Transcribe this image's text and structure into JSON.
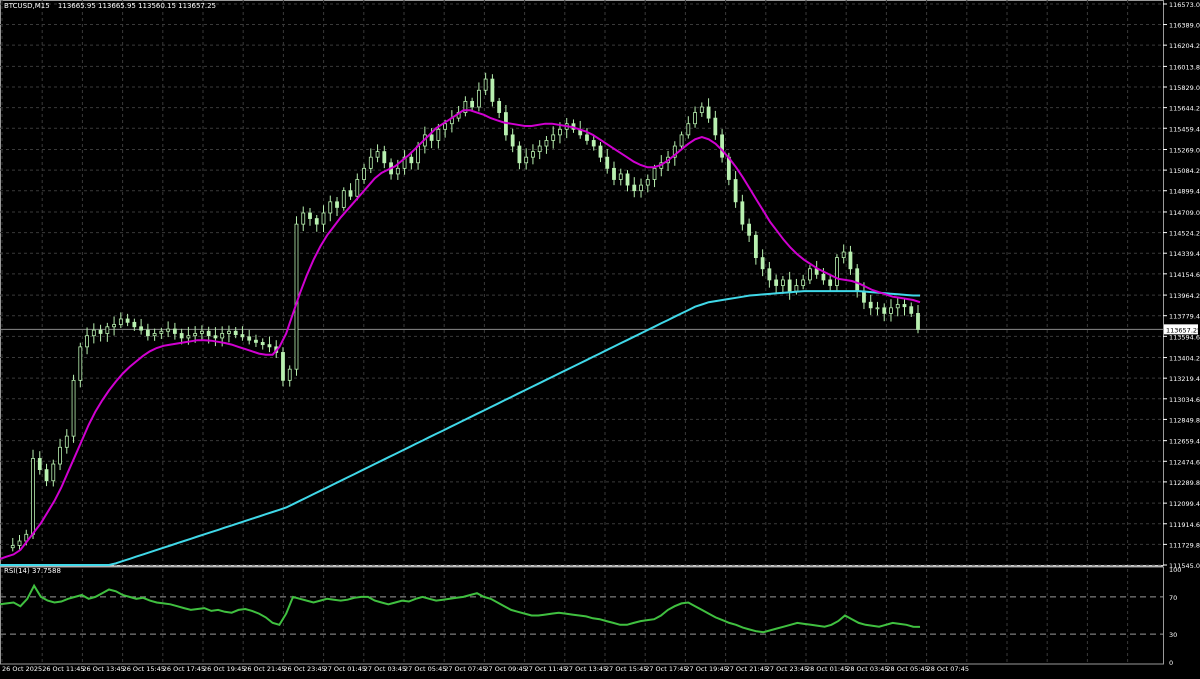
{
  "header": {
    "symbol": "BTCUSD,M15",
    "ohlc": "113665.95 113665.95 113560.15 113657.25"
  },
  "rsi_header": {
    "label": "RSI(14) 37.7588"
  },
  "colors": {
    "background": "#000000",
    "grid": "#3a3a3a",
    "bull_candle": "#b8f0b0",
    "ma_fast": "#d000d0",
    "ma_slow": "#40d8e8",
    "rsi_line": "#40c040",
    "axis_text": "#ffffff"
  },
  "chart_data": {
    "type": "line",
    "title": "BTCUSD,M15",
    "price_axis_labels": [
      "116573.00",
      "116389.00",
      "116204.20",
      "116013.80",
      "115829.00",
      "115644.20",
      "115459.40",
      "115269.00",
      "115084.20",
      "114899.40",
      "114709.00",
      "114524.20",
      "114339.40",
      "114154.60",
      "113964.20",
      "113779.40",
      "113594.60",
      "113404.20",
      "113219.40",
      "113034.60",
      "112849.80",
      "112659.40",
      "112474.60",
      "112289.80",
      "112099.40",
      "111914.60",
      "111729.80",
      "111545.00"
    ],
    "price_range": [
      111545.0,
      116573.0
    ],
    "current_price_label": "113657.25",
    "current_price": 113657.25,
    "time_axis_labels": [
      "26 Oct 2025",
      "26 Oct 11:45",
      "26 Oct 13:45",
      "26 Oct 15:45",
      "26 Oct 17:45",
      "26 Oct 19:45",
      "26 Oct 21:45",
      "26 Oct 23:45",
      "27 Oct 01:45",
      "27 Oct 03:45",
      "27 Oct 05:45",
      "27 Oct 07:45",
      "27 Oct 09:45",
      "27 Oct 11:45",
      "27 Oct 13:45",
      "27 Oct 15:45",
      "27 Oct 17:45",
      "27 Oct 19:45",
      "27 Oct 21:45",
      "27 Oct 23:45",
      "28 Oct 01:45",
      "28 Oct 03:45",
      "28 Oct 05:45",
      "28 Oct 07:45"
    ],
    "close_series": [
      111700,
      111720,
      111760,
      111820,
      112500,
      112400,
      112300,
      112450,
      112600,
      112700,
      113200,
      113500,
      113600,
      113650,
      113620,
      113680,
      113700,
      113750,
      113720,
      113680,
      113650,
      113600,
      113620,
      113640,
      113660,
      113620,
      113580,
      113600,
      113620,
      113640,
      113600,
      113580,
      113620,
      113640,
      113610,
      113590,
      113560,
      113540,
      113520,
      113500,
      113450,
      113200,
      113300,
      114600,
      114700,
      114650,
      114600,
      114700,
      114800,
      114750,
      114900,
      114850,
      115000,
      115100,
      115200,
      115250,
      115150,
      115050,
      115100,
      115200,
      115150,
      115300,
      115400,
      115350,
      115450,
      115500,
      115550,
      115600,
      115700,
      115650,
      115800,
      115900,
      115700,
      115600,
      115400,
      115300,
      115150,
      115200,
      115250,
      115300,
      115350,
      115400,
      115450,
      115500,
      115450,
      115400,
      115350,
      115300,
      115200,
      115100,
      115000,
      115050,
      114950,
      114900,
      114950,
      115000,
      115100,
      115150,
      115200,
      115300,
      115400,
      115500,
      115600,
      115650,
      115550,
      115400,
      115200,
      115000,
      114800,
      114600,
      114500,
      114300,
      114200,
      114100,
      114050,
      114100,
      114000,
      114050,
      114100,
      114200,
      114150,
      114100,
      114050,
      114300,
      114350,
      114200,
      114000,
      113900,
      113850,
      113850,
      113800,
      113850,
      113880,
      113860,
      113800,
      113657
    ],
    "ma_fast": {
      "name": "",
      "values": [
        111600,
        111620,
        111640,
        111680,
        111760,
        111840,
        111920,
        112020,
        112120,
        112240,
        112380,
        112520,
        112660,
        112800,
        112920,
        113020,
        113110,
        113190,
        113260,
        113320,
        113370,
        113420,
        113460,
        113490,
        113510,
        113520,
        113530,
        113540,
        113550,
        113560,
        113560,
        113555,
        113545,
        113535,
        113520,
        113500,
        113480,
        113460,
        113440,
        113430,
        113430,
        113500,
        113620,
        113800,
        113980,
        114140,
        114280,
        114400,
        114500,
        114580,
        114660,
        114730,
        114800,
        114870,
        114940,
        115010,
        115060,
        115090,
        115120,
        115170,
        115220,
        115280,
        115340,
        115400,
        115460,
        115500,
        115540,
        115580,
        115620,
        115620,
        115600,
        115580,
        115550,
        115530,
        115510,
        115500,
        115490,
        115480,
        115480,
        115490,
        115500,
        115500,
        115490,
        115480,
        115470,
        115450,
        115430,
        115400,
        115360,
        115320,
        115280,
        115240,
        115200,
        115160,
        115130,
        115110,
        115110,
        115130,
        115170,
        115220,
        115270,
        115320,
        115360,
        115380,
        115360,
        115320,
        115260,
        115190,
        115110,
        115020,
        114920,
        114820,
        114720,
        114620,
        114540,
        114460,
        114390,
        114330,
        114280,
        114240,
        114200,
        114170,
        114140,
        114110,
        114100,
        114090,
        114070,
        114040,
        114010,
        113990,
        113970,
        113950,
        113940,
        113930,
        113920,
        113900
      ]
    },
    "ma_slow": {
      "name": "",
      "values": [
        111545,
        111545,
        111545,
        111545,
        111545,
        111545,
        111545,
        111545,
        111545,
        111545,
        111545,
        111545,
        111545,
        111545,
        111545,
        111545,
        111545,
        111560,
        111580,
        111600,
        111620,
        111640,
        111660,
        111680,
        111700,
        111720,
        111740,
        111760,
        111780,
        111800,
        111820,
        111840,
        111860,
        111880,
        111900,
        111920,
        111940,
        111960,
        111980,
        112000,
        112020,
        112040,
        112060,
        112090,
        112120,
        112150,
        112180,
        112210,
        112240,
        112270,
        112300,
        112330,
        112360,
        112390,
        112420,
        112450,
        112480,
        112510,
        112540,
        112570,
        112600,
        112630,
        112660,
        112690,
        112720,
        112750,
        112780,
        112810,
        112840,
        112870,
        112900,
        112930,
        112960,
        112990,
        113020,
        113050,
        113080,
        113110,
        113140,
        113170,
        113200,
        113230,
        113260,
        113290,
        113320,
        113350,
        113380,
        113410,
        113440,
        113470,
        113500,
        113530,
        113560,
        113590,
        113620,
        113650,
        113680,
        113710,
        113740,
        113770,
        113800,
        113830,
        113860,
        113880,
        113900,
        113910,
        113920,
        113930,
        113940,
        113950,
        113960,
        113965,
        113970,
        113975,
        113980,
        113985,
        113990,
        113995,
        114000,
        114000,
        114000,
        114000,
        114000,
        114000,
        114000,
        114000,
        114000,
        113995,
        113990,
        113985,
        113980,
        113975,
        113970,
        113965,
        113960,
        113960
      ]
    },
    "rsi": {
      "label": "RSI(14) 37.7588",
      "ylim": [
        0,
        100
      ],
      "levels": [
        70,
        30
      ],
      "axis_labels": [
        "100",
        "70",
        "30",
        "0"
      ],
      "values": [
        62,
        63,
        64,
        60,
        68,
        82,
        70,
        66,
        64,
        65,
        68,
        70,
        72,
        68,
        70,
        74,
        78,
        76,
        72,
        70,
        68,
        69,
        66,
        64,
        63,
        62,
        60,
        58,
        56,
        57,
        58,
        55,
        56,
        54,
        53,
        56,
        57,
        55,
        52,
        48,
        42,
        40,
        52,
        70,
        68,
        66,
        64,
        66,
        68,
        67,
        66,
        67,
        69,
        70,
        70,
        66,
        64,
        62,
        64,
        66,
        65,
        68,
        70,
        68,
        66,
        67,
        68,
        69,
        70,
        72,
        74,
        70,
        68,
        64,
        60,
        56,
        54,
        52,
        50,
        50,
        51,
        52,
        53,
        52,
        51,
        50,
        49,
        47,
        46,
        44,
        42,
        40,
        40,
        42,
        44,
        45,
        46,
        50,
        56,
        60,
        63,
        64,
        60,
        56,
        52,
        48,
        45,
        42,
        40,
        37,
        35,
        33,
        32,
        34,
        36,
        38,
        40,
        42,
        41,
        40,
        39,
        38,
        40,
        44,
        50,
        46,
        42,
        40,
        39,
        38,
        40,
        42,
        41,
        40,
        38,
        37.76
      ]
    }
  }
}
